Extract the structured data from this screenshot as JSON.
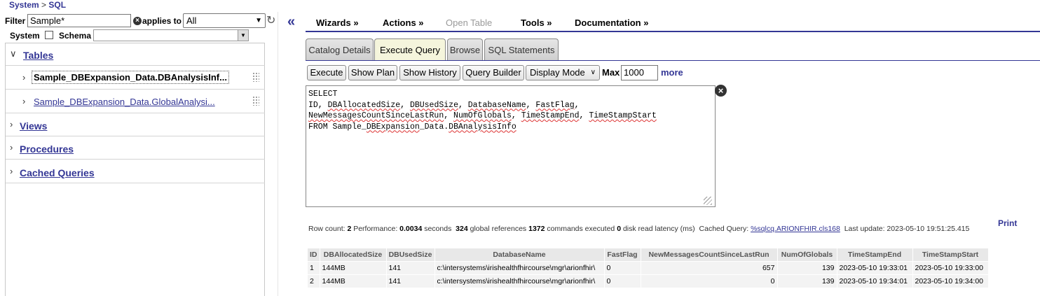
{
  "breadcrumb": {
    "system": "System",
    "separator": " > ",
    "sql": "SQL"
  },
  "filter": {
    "label": "Filter",
    "value": "Sample*",
    "applies_to_label": "applies to",
    "applies_to_value": "All",
    "system_label": "System",
    "schema_label": "Schema",
    "schema_value": ""
  },
  "tree": {
    "tables_label": "Tables",
    "tables": [
      {
        "label": "Sample_DBExpansion_Data.DBAnalysisInf..."
      },
      {
        "label": "Sample_DBExpansion_Data.GlobalAnalysi..."
      }
    ],
    "views_label": "Views",
    "procedures_label": "Procedures",
    "cached_queries_label": "Cached Queries"
  },
  "menu": {
    "wizards": "Wizards »",
    "actions": "Actions »",
    "open_table": "Open Table",
    "tools": "Tools »",
    "documentation": "Documentation »"
  },
  "tabs": [
    {
      "label": "Catalog Details"
    },
    {
      "label": "Execute Query"
    },
    {
      "label": "Browse"
    },
    {
      "label": "SQL Statements"
    }
  ],
  "toolbar": {
    "execute": "Execute",
    "show_plan": "Show Plan",
    "show_history": "Show History",
    "query_builder": "Query Builder",
    "display_mode": "Display Mode",
    "max_label": "Max",
    "max_value": "1000",
    "more": "more"
  },
  "query": {
    "line1": "SELECT",
    "line2_a": "ID, ",
    "line2_b": "DBAllocatedSize",
    "line2_c": ", ",
    "line2_d": "DBUsedSize",
    "line2_e": ", ",
    "line2_f": "DatabaseName",
    "line2_g": ", ",
    "line2_h": "FastFlag",
    "line2_i": ",",
    "line3_a": "NewMessagesCountSinceLastRun",
    "line3_b": ", ",
    "line3_c": "NumOfGlobals",
    "line3_d": ", ",
    "line3_e": "TimeStampEnd",
    "line3_f": ", ",
    "line3_g": "TimeStampStart",
    "line4_a": "FROM Sample_",
    "line4_b": "DBExpansion",
    "line4_c": "_Data.",
    "line4_d": "DBAnalysisInfo"
  },
  "status": {
    "row_count_label": "Row count:",
    "row_count": "2",
    "performance_label": "Performance:",
    "performance": "0.0034",
    "seconds": "seconds",
    "global_refs": "324",
    "global_refs_label": "global references",
    "commands": "1372",
    "commands_label": "commands executed",
    "disk_latency": "0",
    "disk_latency_label": "disk read latency (ms)",
    "cached_query_label": "Cached Query:",
    "cached_query": "%sqlcq.ARIONFHIR.cls168",
    "last_update_label": "Last update:",
    "last_update": "2023-05-10 19:51:25.415",
    "print": "Print"
  },
  "results": {
    "columns": [
      "ID",
      "DBAllocatedSize",
      "DBUsedSize",
      "DatabaseName",
      "FastFlag",
      "NewMessagesCountSinceLastRun",
      "NumOfGlobals",
      "TimeStampEnd",
      "TimeStampStart"
    ],
    "rows": [
      [
        "1",
        "144MB",
        "141",
        "c:\\intersystems\\irishealthfhircourse\\mgr\\arionfhir\\",
        "0",
        "657",
        "139",
        "2023-05-10 19:33:01",
        "2023-05-10 19:33:00"
      ],
      [
        "2",
        "144MB",
        "141",
        "c:\\intersystems\\irishealthfhircourse\\mgr\\arionfhir\\",
        "0",
        "0",
        "139",
        "2023-05-10 19:34:01",
        "2023-05-10 19:34:00"
      ]
    ]
  }
}
